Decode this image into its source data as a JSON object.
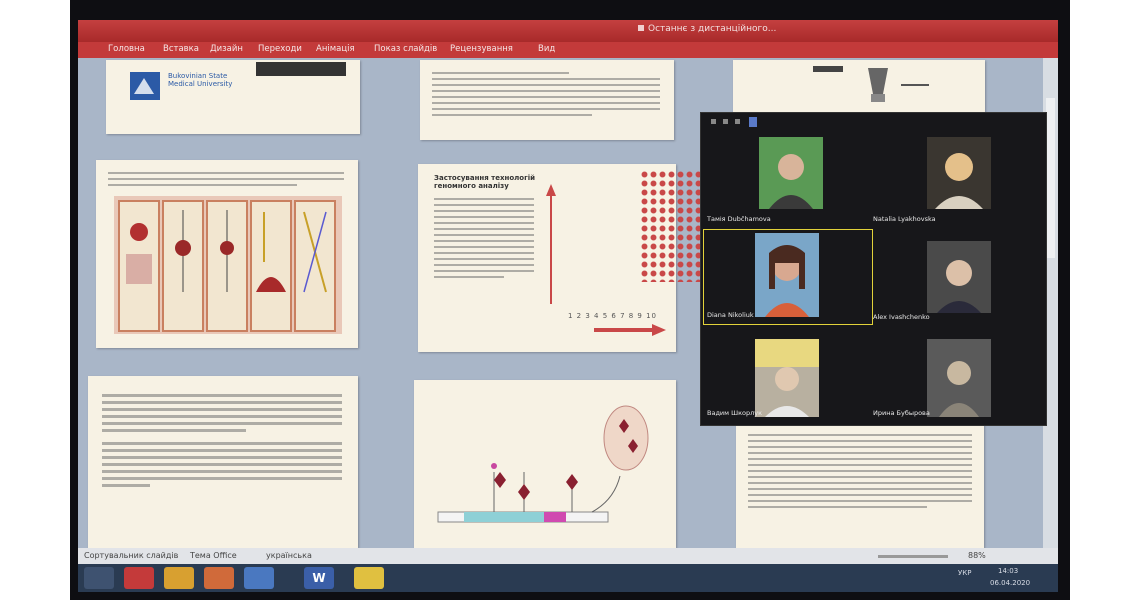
{
  "window": {
    "title": "Останнє з дистанційного..."
  },
  "menu": [
    "Головна",
    "Вставка",
    "Дизайн",
    "Переходи",
    "Анімація",
    "Показ слайдів",
    "Рецензування",
    "Вид"
  ],
  "slides": {
    "logo_caption": "Bukovinian State Medical University",
    "genomic_title": "Застосування технологій геномного аналізу",
    "dot_axis": "1 2 3 4 5 6 7 8 9 10"
  },
  "participants": [
    {
      "name": "Тамія Dubčhamova",
      "bg": "#5a9a55"
    },
    {
      "name": "Natalia Lyakhovska",
      "bg": "#3a3630"
    },
    {
      "name": "Diana Nikoliuk",
      "bg": "#7aa6c8"
    },
    {
      "name": "Alex Ivashchenko",
      "bg": "#4a4a4a"
    },
    {
      "name": "Вадим Шкорлук",
      "bg": "#b8b0a0"
    },
    {
      "name": "Ирина Бубырова",
      "bg": "#5a5a5a"
    }
  ],
  "statusbar": {
    "slide_label": "Сортувальник слайдів",
    "theme": "Тема Office",
    "language": "українська",
    "zoom": "88%"
  },
  "clock": {
    "time": "14:03",
    "date": "06.04.2020",
    "lang": "УКР"
  },
  "colors": {
    "accent": "#c33a3a",
    "taskbar": "#2a3b52"
  }
}
